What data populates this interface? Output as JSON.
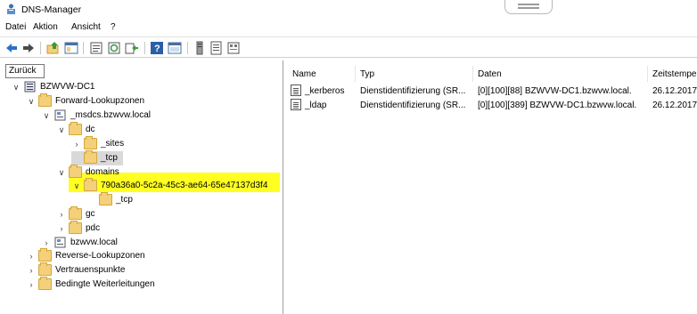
{
  "window": {
    "title": "DNS-Manager"
  },
  "menu": [
    "Datei",
    "Aktion",
    "Ansicht",
    "?"
  ],
  "toolbar": {
    "icons": [
      "back-arrow-icon",
      "forward-arrow-icon",
      "up-folder-icon",
      "show-tree-icon",
      "properties-icon",
      "refresh-icon",
      "export-icon",
      "help-icon",
      "console-icon",
      "server-icon",
      "record-icon",
      "zone-icon"
    ]
  },
  "tooltip": "Zurück",
  "tree": {
    "root": "BZWVW-DC1",
    "forward_zones": "Forward-Lookupzonen",
    "msdcs": "_msdcs.bzwvw.local",
    "dc": "dc",
    "sites": "_sites",
    "tcp": "_tcp",
    "domains": "domains",
    "guid": "790a36a0-5c2a-45c3-ae64-65e47137d3f4",
    "guid_tcp": "_tcp",
    "gc": "gc",
    "pdc": "pdc",
    "bzwvw": "bzwvw.local",
    "reverse_zones": "Reverse-Lookupzonen",
    "trust_points": "Vertrauenspunkte",
    "conditional_forwarders": "Bedingte Weiterleitungen"
  },
  "list": {
    "columns": [
      "Name",
      "Typ",
      "Daten",
      "Zeitstempe"
    ],
    "rows": [
      {
        "name": "_kerberos",
        "type": "Dienstidentifizierung (SR...",
        "data": "[0][100][88] BZWVW-DC1.bzwvw.local.",
        "time": "26.12.2017 ("
      },
      {
        "name": "_ldap",
        "type": "Dienstidentifizierung (SR...",
        "data": "[0][100][389] BZWVW-DC1.bzwvw.local.",
        "time": "26.12.2017 ("
      }
    ]
  },
  "colors": {
    "highlight": "#ffff22",
    "folder": "#f5d07a"
  }
}
